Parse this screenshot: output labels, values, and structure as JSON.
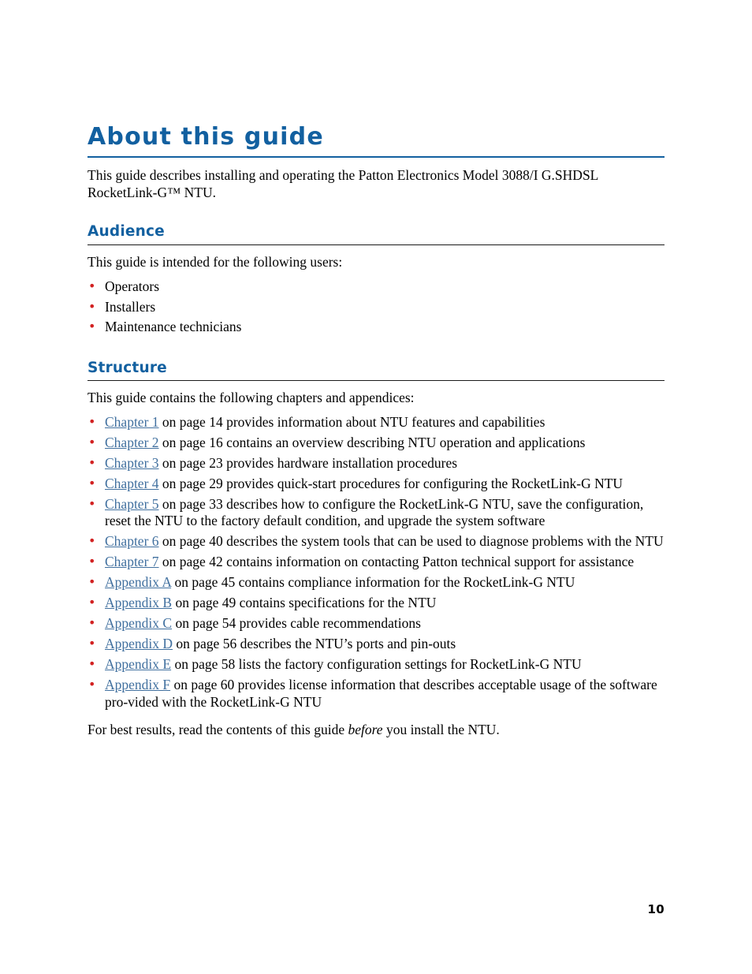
{
  "document": {
    "title": "About this guide",
    "page_number": "10",
    "intro_paragraph": "This guide describes installing and operating the Patton Electronics Model 3088/I G.SHDSL RocketLink-G™ NTU.",
    "colors": {
      "heading_blue": "#1260A0",
      "link_blue": "#41709F",
      "bullet_red": "#D22222",
      "title_rule": "#1260A0",
      "section_rule": "#1a1a1a",
      "body_text": "#000000",
      "page_background": "#ffffff"
    }
  },
  "sections": [
    {
      "heading": "Audience",
      "intro": "This guide is intended for the following users:",
      "items": [
        {
          "link": "",
          "text": "Operators"
        },
        {
          "link": "",
          "text": "Installers"
        },
        {
          "link": "",
          "text": "Maintenance technicians"
        }
      ]
    },
    {
      "heading": "Structure",
      "intro": "This guide contains the following chapters and appendices:",
      "items": [
        {
          "link": "Chapter 1",
          "text": " on page 14 provides information about NTU features and capabilities"
        },
        {
          "link": "Chapter 2",
          "text": " on page 16 contains an overview describing NTU operation and applications"
        },
        {
          "link": "Chapter 3",
          "text": " on page 23 provides hardware installation procedures"
        },
        {
          "link": "Chapter 4",
          "text": " on page 29 provides quick-start procedures for configuring the RocketLink-G NTU"
        },
        {
          "link": "Chapter 5",
          "text": " on page 33 describes how to configure the RocketLink-G NTU, save the configuration, reset the NTU to the factory default condition, and upgrade the system software"
        },
        {
          "link": "Chapter 6",
          "text": " on page 40 describes the system tools that can be used to diagnose problems with the NTU"
        },
        {
          "link": "Chapter 7",
          "text": " on page 42 contains information on contacting Patton technical support for assistance"
        },
        {
          "link": "Appendix A",
          "text": " on page 45 contains compliance information for the RocketLink-G NTU"
        },
        {
          "link": "Appendix B",
          "text": " on page 49 contains specifications for the NTU"
        },
        {
          "link": "Appendix C",
          "text": " on page 54 provides cable recommendations"
        },
        {
          "link": "Appendix D",
          "text": " on page 56 describes the NTU’s ports and pin-outs"
        },
        {
          "link": "Appendix E",
          "text": " on page 58 lists the factory configuration settings for RocketLink-G NTU"
        },
        {
          "link": "Appendix F",
          "text": " on page 60 provides license information that describes acceptable usage of the software pro-vided with the RocketLink-G NTU"
        }
      ],
      "closing": {
        "before_italic": "For best results, read the contents of this guide ",
        "italic": "before",
        "after_italic": " you install the NTU."
      }
    }
  ]
}
